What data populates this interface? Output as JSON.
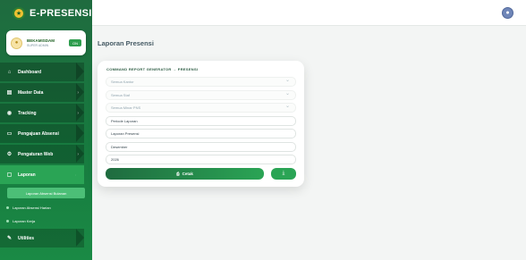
{
  "app": {
    "title": "E-PRESENSI"
  },
  "profile": {
    "name": "BEKAMISDAM",
    "role": "SUPER ADMIN",
    "badge": "ON"
  },
  "sidebar": {
    "items": [
      {
        "label": "Dashboard",
        "icon": "home-icon"
      },
      {
        "label": "Master Data",
        "icon": "database-icon"
      },
      {
        "label": "Tracking",
        "icon": "location-icon"
      },
      {
        "label": "Pengajuan Absensi",
        "icon": "folder-icon"
      },
      {
        "label": "Pengaturan Web",
        "icon": "gear-icon"
      },
      {
        "label": "Laporan",
        "icon": "report-icon"
      },
      {
        "label": "Utilities",
        "icon": "tools-icon"
      }
    ],
    "subitems": [
      {
        "label": "Laporan Absensi Bulanan"
      },
      {
        "label": "Laporan Absensi Harian"
      },
      {
        "label": "Laporan Kerja"
      }
    ]
  },
  "page": {
    "title": "Laporan Presensi"
  },
  "card": {
    "header": "COMMAND REPORT GENERATOR → PRESENSI",
    "selects": [
      {
        "placeholder": "Semua Kantor"
      },
      {
        "placeholder": "Semua Staf"
      },
      {
        "placeholder": "Semua Minar PNS"
      }
    ],
    "inputs": [
      {
        "value": "Periode Laporan"
      },
      {
        "value": "Laporan Presensi"
      },
      {
        "value": "Desember"
      },
      {
        "value": "2026"
      }
    ],
    "print_label": "Cetak",
    "download_icon": "download-icon"
  },
  "colors": {
    "primary": "#1f6b3f",
    "accent": "#2aa455"
  }
}
